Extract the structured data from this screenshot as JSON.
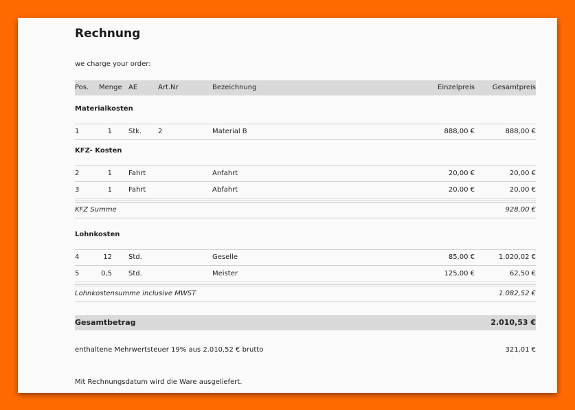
{
  "title": "Rechnung",
  "intro": "we charge your order:",
  "columns": {
    "pos": "Pos.",
    "menge": "Menge",
    "ae": "AE",
    "artnr": "Art.Nr",
    "bezeichnung": "Bezeichnung",
    "einzelpreis": "Einzelpreis",
    "gesamtpreis": "Gesamtpreis"
  },
  "sections": [
    {
      "heading": "Materialkosten",
      "rows": [
        {
          "pos": "1",
          "menge": "1",
          "ae": "Stk.",
          "artnr": "2",
          "bezeichnung": "Material B",
          "einzelpreis": "888,00 €",
          "gesamtpreis": "888,00 €"
        }
      ]
    },
    {
      "heading": "KFZ- Kosten",
      "rows": [
        {
          "pos": "2",
          "menge": "1",
          "ae": "Fahrt",
          "artnr": "",
          "bezeichnung": "Anfahrt",
          "einzelpreis": "20,00 €",
          "gesamtpreis": "20,00 €"
        },
        {
          "pos": "3",
          "menge": "1",
          "ae": "Fahrt",
          "artnr": "",
          "bezeichnung": "Abfahrt",
          "einzelpreis": "20,00 €",
          "gesamtpreis": "20,00 €"
        }
      ],
      "sum_label": "KFZ Summe",
      "sum_value": "928,00 €"
    },
    {
      "heading": "Lohnkosten",
      "rows": [
        {
          "pos": "4",
          "menge": "12",
          "ae": "Std.",
          "artnr": "",
          "bezeichnung": "Geselle",
          "einzelpreis": "85,00 €",
          "gesamtpreis": "1.020,02 €"
        },
        {
          "pos": "5",
          "menge": "0,5",
          "ae": "Std.",
          "artnr": "",
          "bezeichnung": "Meister",
          "einzelpreis": "125,00 €",
          "gesamtpreis": "62,50 €"
        }
      ],
      "sum_label": "Lohnkostensumme inclusive MWST",
      "sum_value": "1.082,52 €"
    }
  ],
  "total": {
    "label": "Gesamtbetrag",
    "value": "2.010,53 €"
  },
  "vat_note": {
    "label": "enthaltene Mehrwertsteuer 19% aus 2.010,52 € brutto",
    "value": "321,01 €"
  },
  "footer_note": "Mit Rechnungsdatum wird die Ware ausgeliefert."
}
